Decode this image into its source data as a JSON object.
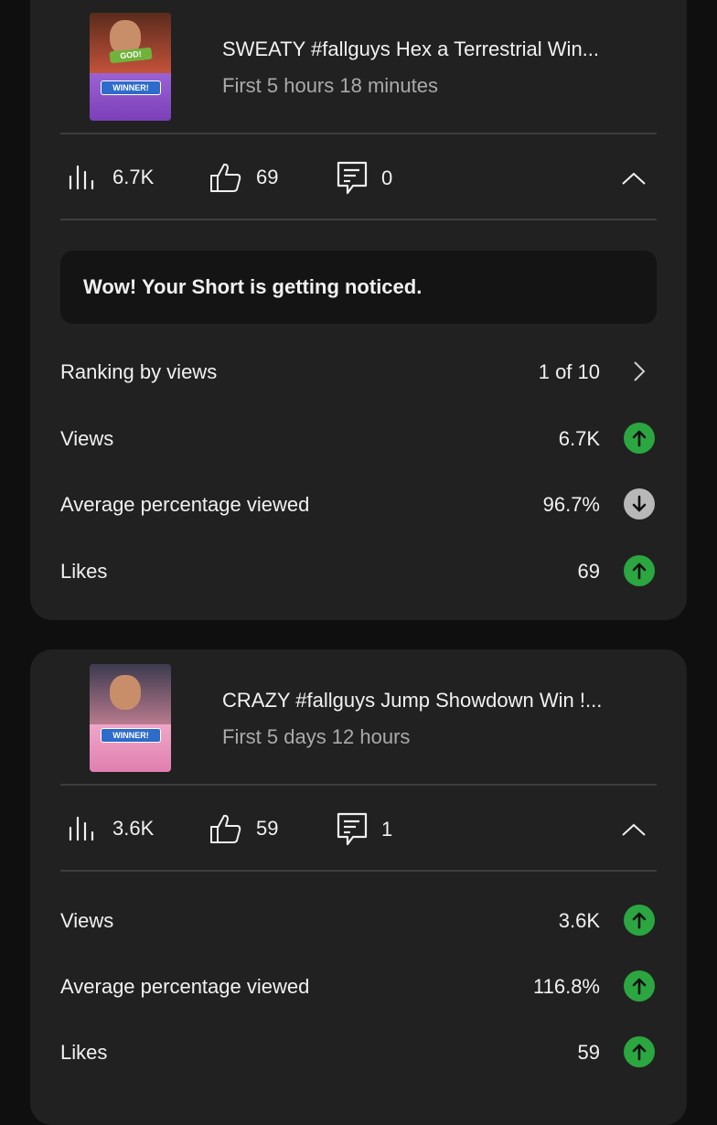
{
  "cards": [
    {
      "title": "SWEATY #fallguys Hex a Terrestrial Win...",
      "subtitle": "First 5 hours 18 minutes",
      "thumbnail": {
        "tag": "GOD!",
        "badge": "WINNER!"
      },
      "stats": {
        "views": "6.7K",
        "likes": "69",
        "comments": "0"
      },
      "banner": "Wow! Your Short is getting noticed.",
      "ranking": {
        "label": "Ranking by views",
        "value": "1 of 10"
      },
      "metrics": [
        {
          "label": "Views",
          "value": "6.7K",
          "trend": "up"
        },
        {
          "label": "Average percentage viewed",
          "value": "96.7%",
          "trend": "down"
        },
        {
          "label": "Likes",
          "value": "69",
          "trend": "up"
        }
      ]
    },
    {
      "title": "CRAZY #fallguys Jump Showdown Win !...",
      "subtitle": "First 5 days 12 hours",
      "thumbnail": {
        "badge": "WINNER!"
      },
      "stats": {
        "views": "3.6K",
        "likes": "59",
        "comments": "1"
      },
      "metrics": [
        {
          "label": "Views",
          "value": "3.6K",
          "trend": "up"
        },
        {
          "label": "Average percentage viewed",
          "value": "116.8%",
          "trend": "up"
        },
        {
          "label": "Likes",
          "value": "59",
          "trend": "up"
        }
      ]
    }
  ],
  "colors": {
    "up": "#2ba640",
    "down": "#b8b8b8",
    "card": "#212121",
    "background": "#0f0f0f"
  }
}
